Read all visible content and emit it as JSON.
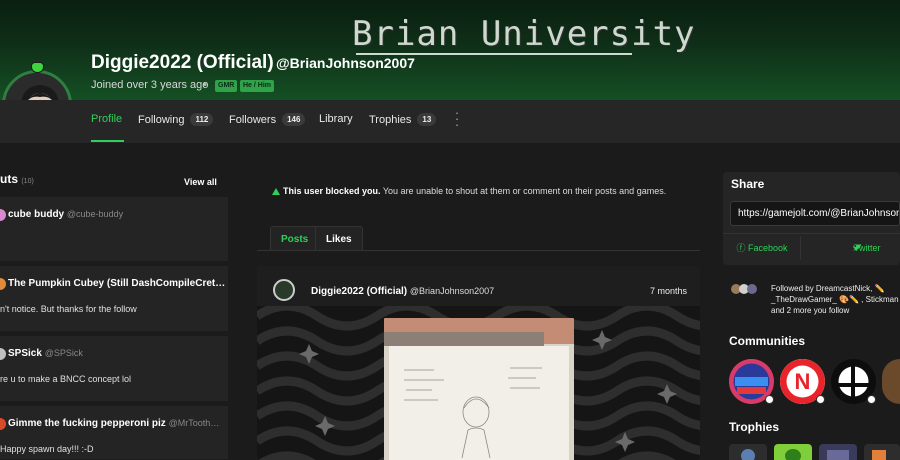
{
  "banner": {
    "text": "Brian University"
  },
  "profile": {
    "display_name": "Diggie2022 (Official)",
    "handle": "@BrianJohnson2007",
    "joined": "Joined over 3 years ago",
    "tags": [
      "GMR",
      "He / Him"
    ]
  },
  "tabs": [
    {
      "label": "Profile"
    },
    {
      "label": "Following",
      "count": "112"
    },
    {
      "label": "Followers",
      "count": "146"
    },
    {
      "label": "Library"
    },
    {
      "label": "Trophies",
      "count": "13"
    }
  ],
  "shouts": {
    "title": "uts",
    "count": "(10)",
    "view_all": "View all",
    "items": [
      {
        "name": "cube buddy",
        "handle": "@cube-buddy",
        "body": ""
      },
      {
        "name": "The Pumpkin Cubey (Still DashCompileCret…",
        "handle": "",
        "body": "n't notice. But thanks for the follow"
      },
      {
        "name": "SPSick",
        "handle": "@SPSick",
        "body": "re u to make a BNCC concept lol"
      },
      {
        "name": "Gimme the fucking pepperoni piz",
        "handle": "@MrTooth…",
        "body": "Happy spawn day!!! :-D"
      }
    ]
  },
  "blocked": {
    "strong": "This user blocked you.",
    "rest": " You are unable to shout at them or comment on their posts and games."
  },
  "post_tabs": {
    "posts": "Posts",
    "likes": "Likes"
  },
  "post": {
    "name": "Diggie2022 (Official)",
    "handle": "@BrianJohnson2007",
    "time": "7 months"
  },
  "share": {
    "title": "Share",
    "url": "https://gamejolt.com/@BrianJohnson2007",
    "facebook": "Facebook",
    "twitter": "Twitter"
  },
  "followed_by": "Followed by DreamcastNick, ✏️ _TheDrawGamer_ 🎨✏️ , Stickman and 2 more you follow",
  "communities": {
    "title": "Communities"
  },
  "trophies": {
    "title": "Trophies"
  },
  "colors": {
    "accent": "#2fcf59",
    "banner": "#0f2f18",
    "bg": "#1b1b1b"
  }
}
